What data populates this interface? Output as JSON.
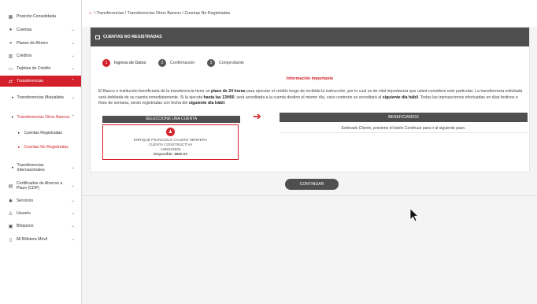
{
  "sidebar": {
    "items": [
      {
        "label": "Posición Consolidada",
        "icon": "grid-icon",
        "chevron": ""
      },
      {
        "label": "Cuentas",
        "icon": "wallet-icon",
        "chevron": "⌄"
      },
      {
        "label": "Planes de Ahorro",
        "icon": "piggy-bank-icon",
        "chevron": "⌄"
      },
      {
        "label": "Créditos",
        "icon": "bar-chart-icon",
        "chevron": "⌄"
      },
      {
        "label": "Tarjetas de Crédito",
        "icon": "credit-card-icon",
        "chevron": "⌄"
      },
      {
        "label": "Transferencias",
        "icon": "transfer-icon",
        "chevron": "⌃"
      },
      {
        "label": "Certificados de Ahorros a Plazo (CDP)",
        "icon": "certificate-icon",
        "chevron": "⌄"
      },
      {
        "label": "Servicios",
        "icon": "services-icon",
        "chevron": "⌄"
      },
      {
        "label": "Usuario",
        "icon": "user-icon",
        "chevron": "⌄"
      },
      {
        "label": "Bloqueos",
        "icon": "lock-icon",
        "chevron": "⌄"
      },
      {
        "label": "Mi Billetera Móvil",
        "icon": "phone-icon",
        "chevron": "⌄"
      }
    ],
    "transfer_sub": [
      {
        "label": "Transferencias Mutualista",
        "chevron": "⌄"
      },
      {
        "label": "Transferencias Otros Bancos",
        "chevron": "⌃"
      },
      {
        "label": "Transferencias Internacionales",
        "chevron": "⌄"
      }
    ],
    "other_banks_sub": [
      {
        "label": "Cuentas Registradas"
      },
      {
        "label": "Cuentas No Registradas"
      }
    ]
  },
  "breadcrumb": {
    "text": "/ Transferencias / Transferencias Otros Bancos / Cuentas No Registradas"
  },
  "card": {
    "title": "CUENTAS NO REGISTRADAS",
    "steps": [
      {
        "num": "1",
        "label": "Ingreso de Datos"
      },
      {
        "num": "2",
        "label": "Confirmación"
      },
      {
        "num": "3",
        "label": "Comprobante"
      }
    ],
    "info_title": "Información importante",
    "info_p1": "El Banco o institución beneficiaria de la transferencia tiene un ",
    "info_b1": "plazo de 24 horas",
    "info_p2": " para ejecutar el crédito luego de recibida la instrucción, por lo cual es de vital importancia que usted considere este particular. La transferencia solicitada será debitada de su cuenta inmediatamente. Si la ejecuta ",
    "info_b2": "hasta las 13H00",
    "info_p3": ", será acreditada a la cuenta destino el mismo día, caso contrario se acreditará al ",
    "info_b3": "siguiente día hábil",
    "info_p4": ". Todas las transacciones efectuadas en días festivos o fines de semana, serán registradas con fecha del ",
    "info_b4": "siguiente día hábil",
    "info_p5": ".",
    "select_label": "SELECCIONE UNA CUENTA",
    "account": {
      "name": "ENRIQUE FRANCISCO CALERO HERRERA",
      "type": "CUENTA CONSTRUCTIVA",
      "number": "1486218835",
      "available": "Disponible: $800.03"
    },
    "arrow": "➔",
    "beneficiaries_label": "BENEFICIARIOS",
    "beneficiaries_text": "Estimado Cliente, presione el botón Continuar para ir al siguiente paso."
  },
  "continue_label": "CONTINUAR"
}
